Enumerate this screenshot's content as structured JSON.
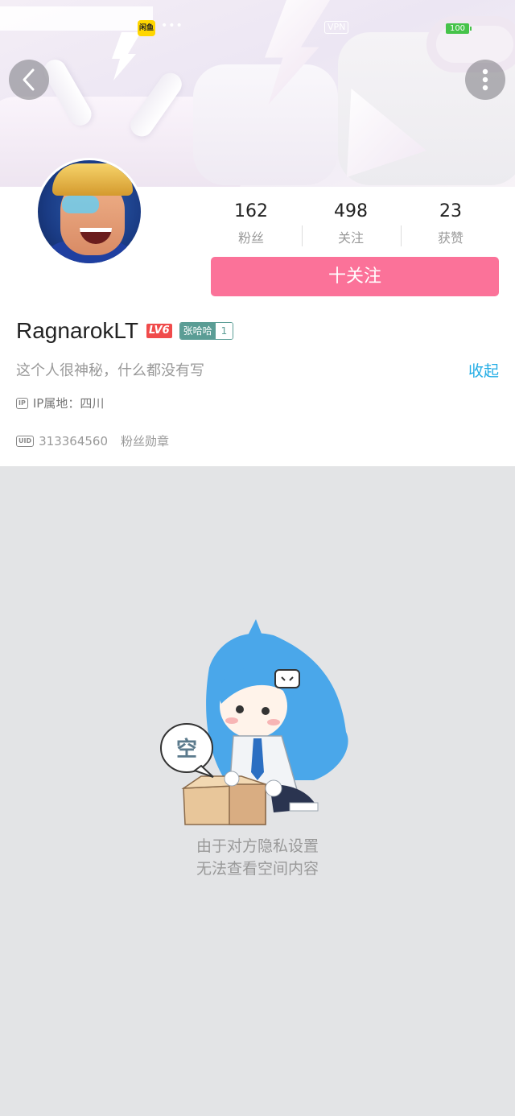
{
  "status_bar": {
    "app_badge": "闲鱼",
    "dots": "•••",
    "vpn": "VPN",
    "battery": "100"
  },
  "stats": [
    {
      "value": "162",
      "label": "粉丝"
    },
    {
      "value": "498",
      "label": "关注"
    },
    {
      "value": "23",
      "label": "获赞"
    }
  ],
  "follow_button": "十关注",
  "user": {
    "name": "RagnarokLT",
    "level": "LV6",
    "medal_name": "张哈哈",
    "medal_level": "1",
    "bio": "这个人很神秘，什么都没有写",
    "collapse": "收起",
    "ip_tag": "IP",
    "ip_location": "IP属地：四川",
    "uid_tag": "UID",
    "uid": "313364560",
    "fans_medal": "粉丝勋章"
  },
  "empty_state": {
    "bubble_text": "空",
    "line1": "由于对方隐私设置",
    "line2": "无法查看空间内容"
  },
  "colors": {
    "accent_pink": "#fb7299",
    "link_blue": "#23ade5",
    "level_red": "#f04b4b",
    "medal_teal": "#5b9d95",
    "empty_bg": "#e3e4e6"
  }
}
